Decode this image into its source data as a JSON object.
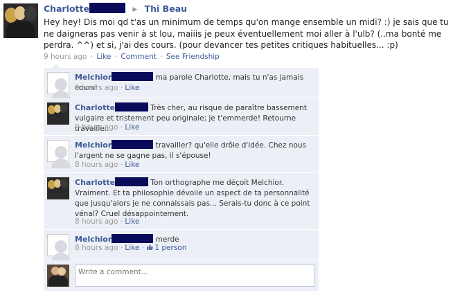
{
  "post": {
    "author": "Charlotte",
    "target": "Thi Beau",
    "body": "Hey hey! Dis moi qd t'as un minimum de temps qu'on mange ensemble un midi? :) je sais que tu ne daigneras pas venir à st lou, maiiis je peux éventuellement moi aller à l'ulb? (..ma bonté me perdra. ^^) et si, j'ai des cours. (pour devancer tes petites critiques habituelles... :p)",
    "time": "9 hours ago",
    "like": "Like",
    "comment": "Comment",
    "see_friendship": "See Friendship"
  },
  "comments": [
    {
      "name": "Melchior",
      "text": "ma parole Charlotte, mais tu n'as jamais cours!",
      "time": "9 hours ago",
      "like": "Like"
    },
    {
      "name": "Charlotte",
      "text": "Très cher, au risque de paraître bassement vulgaire et tristement peu originale; je t'emmerde! Retourne travailler.",
      "time": "9 hours ago",
      "like": "Like"
    },
    {
      "name": "Melchior",
      "text": "travailler? qu'elle drôle d'idée. Chez nous l'argent ne se gagne pas, il s'épouse!",
      "time": "8 hours ago",
      "like": "Like"
    },
    {
      "name": "Charlotte",
      "text": "Ton orthographe me déçoit Melchior. Vraiment. Et ta philosophie dévoile un aspect de ta personnalité que jusqu'alors je ne connaissais pas... Serais-tu donc à ce point vénal? Cruel désappointement.",
      "time": "8 hours ago",
      "like": "Like"
    },
    {
      "name": "Melchior",
      "text": "merde",
      "time": "8 hours ago",
      "like": "Like",
      "likes_count": "1 person"
    }
  ],
  "write_comment": {
    "placeholder": "Write a comment..."
  },
  "colors": {
    "link": "#3b5998",
    "comment_bg": "#eceff5",
    "redaction": "#0a0a5a"
  },
  "icons": {
    "thumb": "thumbs-up-icon",
    "arrow": "triangle-right-icon"
  }
}
